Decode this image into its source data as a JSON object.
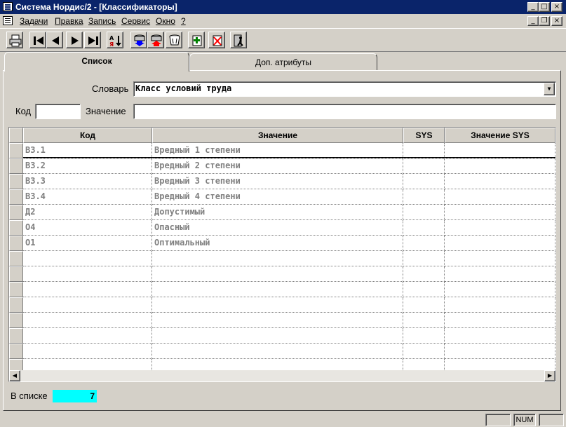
{
  "window": {
    "title": "Система Нордис/2 - [Классификаторы]",
    "controls": [
      "_",
      "□",
      "×"
    ],
    "mdi_controls": [
      "_",
      "❐",
      "×"
    ]
  },
  "menu": [
    "Задачи",
    "Правка",
    "Запись",
    "Сервис",
    "Окно",
    "?"
  ],
  "toolbar": {
    "icons": [
      "printer-icon",
      "first-record-icon",
      "prev-record-icon",
      "next-record-icon",
      "last-record-icon",
      "sort-az-icon",
      "db-down-icon",
      "db-up-icon",
      "db-clear-icon",
      "add-record-icon",
      "delete-record-icon",
      "exit-icon"
    ]
  },
  "tabs": [
    "Список",
    "Доп. атрибуты"
  ],
  "filter": {
    "dict_label": "Словарь",
    "dict_value": "Класс условий труда",
    "code_label": "Код",
    "code_value": "",
    "value_label": "Значение",
    "value_value": ""
  },
  "grid": {
    "columns": [
      "Код",
      "Значение",
      "SYS",
      "Значение SYS"
    ],
    "rows": [
      {
        "code": "В3.1",
        "value": "Вредный 1 степени",
        "sys": "",
        "sys_value": ""
      },
      {
        "code": "В3.2",
        "value": "Вредный 2 степени",
        "sys": "",
        "sys_value": ""
      },
      {
        "code": "В3.3",
        "value": "Вредный 3 степени",
        "sys": "",
        "sys_value": ""
      },
      {
        "code": "В3.4",
        "value": "Вредный 4 степени",
        "sys": "",
        "sys_value": ""
      },
      {
        "code": "Д2",
        "value": "Допустимый",
        "sys": "",
        "sys_value": ""
      },
      {
        "code": "О4",
        "value": "Опасный",
        "sys": "",
        "sys_value": ""
      },
      {
        "code": "О1",
        "value": "Оптимальный",
        "sys": "",
        "sys_value": ""
      }
    ],
    "empty_rows": 8
  },
  "footer": {
    "count_label": "В списке",
    "count_value": "7",
    "count_color": "#00ffff"
  },
  "status": {
    "panels": [
      "",
      "NUM",
      ""
    ]
  },
  "colors": {
    "titlebar": "#0a246a",
    "face": "#d4d0c8"
  }
}
